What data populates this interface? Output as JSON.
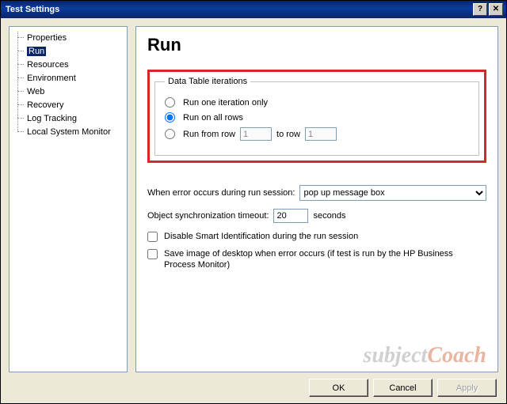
{
  "titlebar": {
    "title": "Test Settings"
  },
  "tree": {
    "items": [
      {
        "label": "Properties"
      },
      {
        "label": "Run"
      },
      {
        "label": "Resources"
      },
      {
        "label": "Environment"
      },
      {
        "label": "Web"
      },
      {
        "label": "Recovery"
      },
      {
        "label": "Log Tracking"
      },
      {
        "label": "Local System Monitor"
      }
    ],
    "selected": "Run"
  },
  "page": {
    "heading": "Run",
    "dataTable": {
      "legend": "Data Table iterations",
      "opt_one": "Run one iteration only",
      "opt_all": "Run on all rows",
      "opt_from": "Run from row",
      "to_label": "to row",
      "from_value": "1",
      "to_value": "1",
      "selected": "all"
    },
    "error": {
      "label": "When error occurs during run session:",
      "value": "pop up message box"
    },
    "sync": {
      "label": "Object synchronization timeout:",
      "value": "20",
      "unit": "seconds"
    },
    "chk_smart": "Disable Smart Identification during the run session",
    "chk_save": "Save image of desktop when error occurs (if test is run by the HP Business Process Monitor)"
  },
  "buttons": {
    "ok": "OK",
    "cancel": "Cancel",
    "apply": "Apply"
  },
  "watermark": {
    "a": "subject",
    "b": "Coach"
  }
}
